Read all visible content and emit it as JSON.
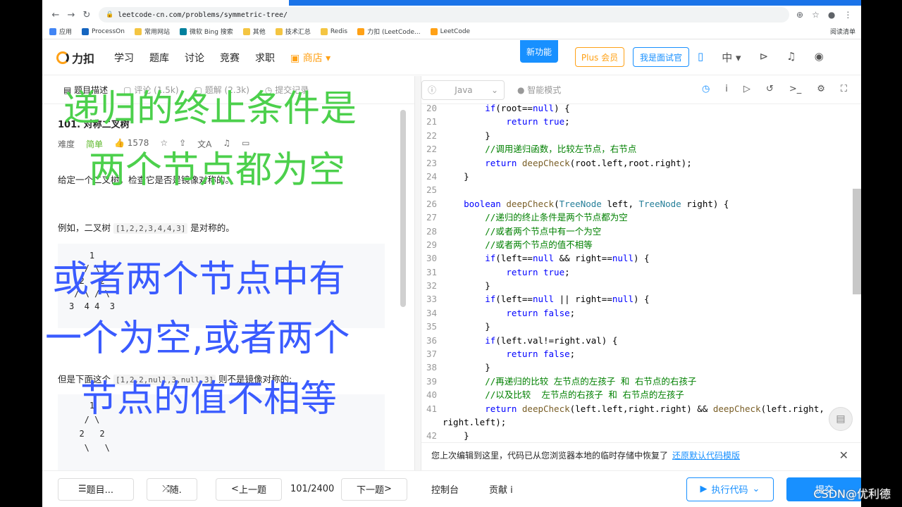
{
  "browser": {
    "url": "leetcode-cn.com/problems/symmetric-tree/",
    "bookmarks": [
      "应用",
      "ProcessOn",
      "常用网站",
      "微软 Bing 搜索",
      "其他",
      "技术汇总",
      "Redis",
      "力扣 (LeetCode...",
      "LeetCode"
    ],
    "reading_list": "阅读清单"
  },
  "site": {
    "logo": "力扣",
    "nav": [
      "学习",
      "题库",
      "讨论",
      "竞赛",
      "求职",
      "商店"
    ],
    "new_feature": "新功能",
    "plus": "Plus 会员",
    "interviewer": "我是面试官",
    "lang": "中"
  },
  "problem": {
    "tabs": [
      "题目描述",
      "评论 (1.5k)",
      "题解 (2.3k)",
      "提交记录"
    ],
    "title": "101. 对称二叉树",
    "difficulty_label": "难度",
    "difficulty": "简单",
    "likes": "1578",
    "description": "给定一个二叉树，检查它是否是镜像对称的。",
    "example_prefix": "例如，二叉树 ",
    "example_array": "[1,2,2,3,4,4,3]",
    "example_suffix": " 是对称的。",
    "tree1": "    1\n   / \\\n  2   2\n / \\ / \\\n3  4 4  3",
    "but_prefix": "但是下面这个 ",
    "but_array": "[1,2,2,null,3,null,3]",
    "but_suffix": " 则不是镜像对称的:",
    "tree2": "    1\n   / \\\n  2   2\n   \\   \\"
  },
  "editor": {
    "language": "Java",
    "smart_mode": "智能模式",
    "restore_msg": "您上次编辑到这里，代码已从您浏览器本地的临时存储中恢复了",
    "restore_link": "还原默认代码模版"
  },
  "code_lines": [
    {
      "n": "20",
      "t": "        if(root==null) {"
    },
    {
      "n": "21",
      "t": "            return true;"
    },
    {
      "n": "22",
      "t": "        }"
    },
    {
      "n": "22",
      "t": "        //调用递归函数，比较左节点，右节点"
    },
    {
      "n": "23",
      "t": "        return deepCheck(root.left,root.right);"
    },
    {
      "n": "24",
      "t": "    }"
    },
    {
      "n": "25",
      "t": ""
    },
    {
      "n": "26",
      "t": "    boolean deepCheck(TreeNode left, TreeNode right) {"
    },
    {
      "n": "27",
      "t": "        //递归的终止条件是两个节点都为空"
    },
    {
      "n": "28",
      "t": "        //或者两个节点中有一个为空"
    },
    {
      "n": "29",
      "t": "        //或者两个节点的值不相等"
    },
    {
      "n": "30",
      "t": "        if(left==null && right==null) {"
    },
    {
      "n": "31",
      "t": "            return true;"
    },
    {
      "n": "32",
      "t": "        }"
    },
    {
      "n": "33",
      "t": "        if(left==null || right==null) {"
    },
    {
      "n": "34",
      "t": "            return false;"
    },
    {
      "n": "35",
      "t": "        }"
    },
    {
      "n": "36",
      "t": "        if(left.val!=right.val) {"
    },
    {
      "n": "37",
      "t": "            return false;"
    },
    {
      "n": "38",
      "t": "        }"
    },
    {
      "n": "39",
      "t": "        //再递归的比较 左节点的左孩子 和 右节点的右孩子"
    },
    {
      "n": "40",
      "t": "        //以及比较  左节点的右孩子 和 右节点的左孩子"
    },
    {
      "n": "41",
      "t": "        return deepCheck(left.left,right.right) && deepCheck(left.right,"
    },
    {
      "n": "",
      "t": "right.left);"
    },
    {
      "n": "42",
      "t": "    }"
    }
  ],
  "bottom": {
    "problem_list": "题目...",
    "random": "随.",
    "prev": "上一题",
    "page": "101/2400",
    "next": "下一题",
    "console": "控制台",
    "contribute": "贡献 i",
    "run": "执行代码",
    "submit": "提交"
  },
  "overlay": {
    "line1": "递归的终止条件是",
    "line2": "两个节点都为空",
    "line3": "或者两个节点中有",
    "line4": "一个为空,或者两个",
    "line5": "节点的值不相等"
  },
  "watermark": "CSDN@优利德"
}
